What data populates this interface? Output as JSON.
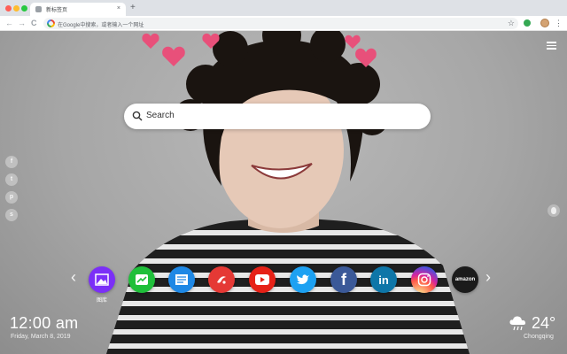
{
  "browser": {
    "tab_title": "新标签页",
    "tab_close": "×",
    "new_tab": "+",
    "back": "←",
    "forward": "→",
    "reload": "C",
    "omnibox_placeholder": "在Google中搜索，或者输入一个网址",
    "bookmark_star": "☆",
    "menu": "⋮"
  },
  "search": {
    "placeholder": "Search"
  },
  "social_icons": [
    "f",
    "t",
    "p",
    "s"
  ],
  "dock": {
    "prev": "‹",
    "next": "›",
    "apps": [
      {
        "name": "gallery",
        "label": "图库",
        "color": "#7b2ff7"
      },
      {
        "name": "stocks",
        "label": "",
        "color": "#1fbf3a"
      },
      {
        "name": "news",
        "label": "",
        "color": "#1e88e5"
      },
      {
        "name": "game",
        "label": "",
        "color": "#e53935"
      },
      {
        "name": "youtube",
        "label": "",
        "color": "#e62117"
      },
      {
        "name": "twitter",
        "label": "",
        "color": "#1da1f2"
      },
      {
        "name": "facebook",
        "label": "",
        "color": "#3b5998"
      },
      {
        "name": "linkedin",
        "label": "",
        "color": "#0e76a8"
      },
      {
        "name": "instagram",
        "label": "",
        "color": "#d62976"
      },
      {
        "name": "amazon",
        "label": "",
        "color": "#1b1b1b"
      }
    ],
    "instagram_text": "",
    "amazon_text": "amazon",
    "facebook_text": "f",
    "linkedin_text": "in"
  },
  "clock": {
    "time": "12:00 am",
    "date": "Friday, March 8, 2019"
  },
  "weather": {
    "temp": "24°",
    "city": "Chongqing",
    "icon": "cloud-rain-icon"
  }
}
